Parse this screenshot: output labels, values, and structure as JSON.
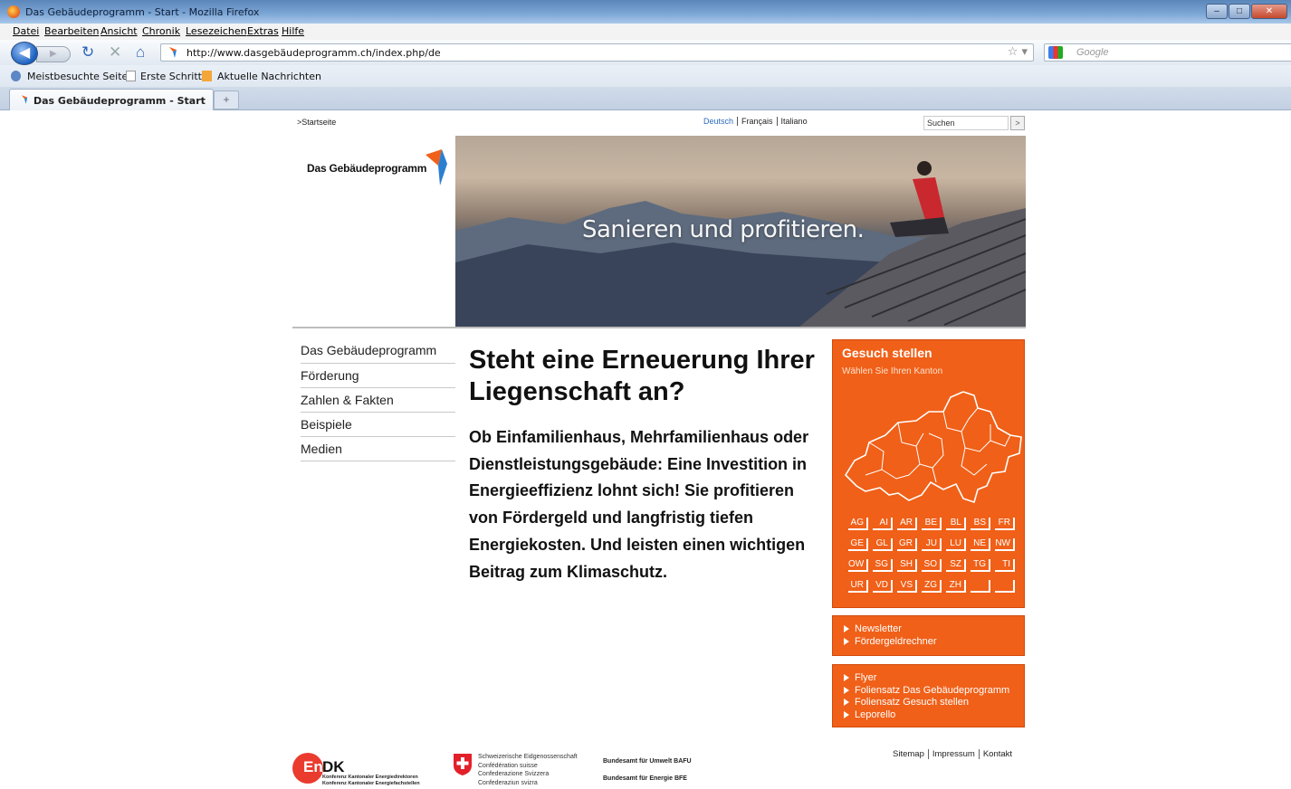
{
  "browser": {
    "window_title": "Das Gebäudeprogramm - Start - Mozilla Firefox",
    "menu": [
      "Datei",
      "Bearbeiten",
      "Ansicht",
      "Chronik",
      "Lesezeichen",
      "Extras",
      "Hilfe"
    ],
    "url": "http://www.dasgebäudeprogramm.ch/index.php/de",
    "search_placeholder": "Google",
    "bookmarks": [
      "Meistbesuchte Seiten",
      "Erste Schritte",
      "Aktuelle Nachrichten"
    ],
    "tab_title": "Das Gebäudeprogramm - Start",
    "new_tab": "+"
  },
  "page": {
    "breadcrumb": ">Startseite",
    "languages": [
      "Deutsch",
      "Français",
      "Italiano"
    ],
    "search_value": "Suchen",
    "search_button": ">",
    "logo_text": "Das Gebäudeprogramm",
    "hero_tagline": "Sanieren und profitieren.",
    "nav": [
      "Das Gebäudeprogramm",
      "Förderung",
      "Zahlen & Fakten",
      "Beispiele",
      "Medien"
    ],
    "headline": "Steht eine Erneuerung Ihrer Liegenschaft an?",
    "lead": "Ob Einfamilienhaus, Mehrfamilienhaus oder Dienstleistungsgebäude: Eine Investition in Energieeffizienz lohnt sich! Sie profitieren von Fördergeld und langfristig tiefen Energiekosten. Und leisten einen wichtigen Beitrag zum Klimaschutz.",
    "gesuch": {
      "title": "Gesuch stellen",
      "subtitle": "Wählen Sie Ihren Kanton",
      "cantons": [
        "AG",
        "AI",
        "AR",
        "BE",
        "BL",
        "BS",
        "FR",
        "GE",
        "GL",
        "GR",
        "JU",
        "LU",
        "NE",
        "NW",
        "OW",
        "SG",
        "SH",
        "SO",
        "SZ",
        "TG",
        "TI",
        "UR",
        "VD",
        "VS",
        "ZG",
        "ZH",
        "",
        ""
      ]
    },
    "links1": [
      "Newsletter",
      "Fördergeldrechner"
    ],
    "links2": [
      "Flyer",
      "Foliensatz Das Gebäudeprogramm",
      "Foliensatz Gesuch stellen",
      "Leporello"
    ],
    "footer": {
      "endk_en": "En",
      "endk_dk": "DK",
      "endk_sub1": "Konferenz Kantonaler Energiedirektoren",
      "endk_sub2": "Konferenz Kantonaler Energiefachstellen",
      "confed": [
        "Schweizerische Eidgenossenschaft",
        "Confédération suisse",
        "Confederazione Svizzera",
        "Confederaziun svizra"
      ],
      "bafu": "Bundesamt für Umwelt BAFU",
      "bfe": "Bundesamt für Energie BFE",
      "links": [
        "Sitemap",
        "Impressum",
        "Kontakt"
      ]
    }
  },
  "colors": {
    "accent": "#f06018",
    "link_active": "#2b6bc1"
  }
}
